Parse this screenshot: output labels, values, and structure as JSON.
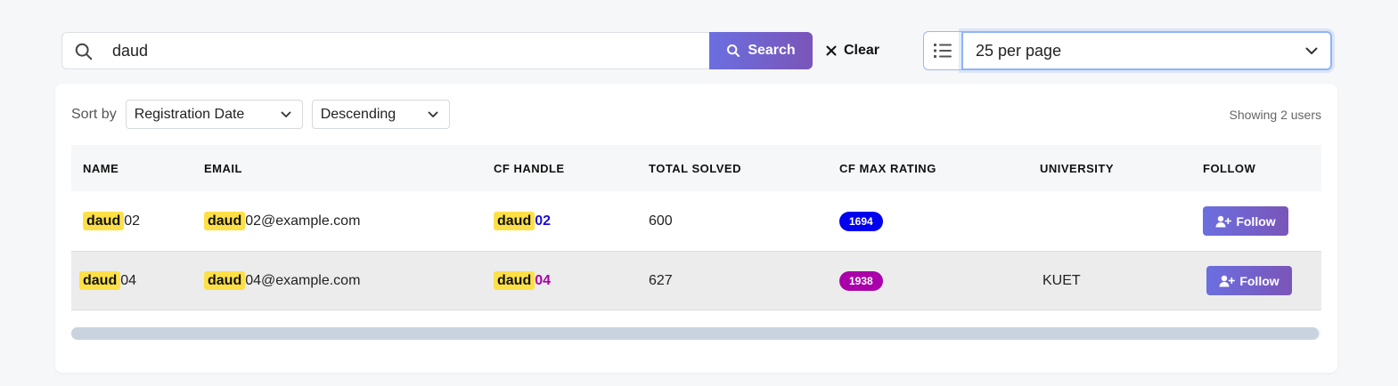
{
  "search": {
    "value": "daud",
    "button_label": "Search",
    "clear_label": "Clear"
  },
  "per_page": {
    "selected": "25 per page"
  },
  "sort": {
    "label": "Sort by",
    "field": "Registration Date",
    "order": "Descending"
  },
  "showing_text": "Showing 2 users",
  "table": {
    "headers": [
      "NAME",
      "EMAIL",
      "CF HANDLE",
      "TOTAL SOLVED",
      "CF MAX RATING",
      "UNIVERSITY",
      "FOLLOW"
    ],
    "rows": [
      {
        "name_match": "daud",
        "name_rest": "02",
        "email_match": "daud",
        "email_rest": "02@example.com",
        "handle_match": "daud",
        "handle_rest": "02",
        "handle_color": "#1a0dde",
        "total_solved": "600",
        "rating": "1694",
        "rating_color": "#0000ee",
        "university": "",
        "follow_label": "Follow"
      },
      {
        "name_match": "daud",
        "name_rest": "04",
        "email_match": "daud",
        "email_rest": "04@example.com",
        "handle_match": "daud",
        "handle_rest": "04",
        "handle_color": "#aa00aa",
        "total_solved": "627",
        "rating": "1938",
        "rating_color": "#aa00aa",
        "university": "KUET",
        "follow_label": "Follow"
      }
    ]
  }
}
